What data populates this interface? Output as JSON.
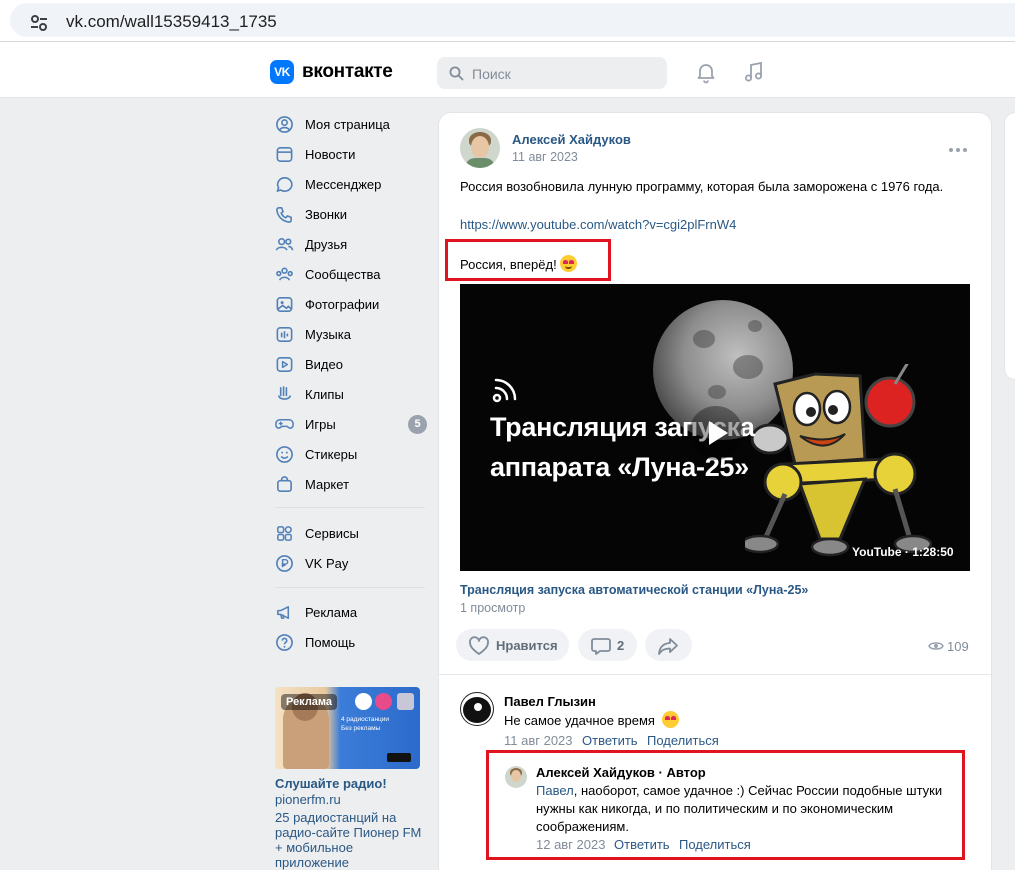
{
  "browser": {
    "url": "vk.com/wall15359413_1735"
  },
  "header": {
    "logo_text": "вконтакте",
    "logo_mark": "VK",
    "search_placeholder": "Поиск"
  },
  "sidebar": {
    "items": [
      {
        "label": "Моя страница",
        "icon": "user-circle-icon"
      },
      {
        "label": "Новости",
        "icon": "news-icon"
      },
      {
        "label": "Мессенджер",
        "icon": "message-icon"
      },
      {
        "label": "Звонки",
        "icon": "phone-icon"
      },
      {
        "label": "Друзья",
        "icon": "friends-icon"
      },
      {
        "label": "Сообщества",
        "icon": "communities-icon"
      },
      {
        "label": "Фотографии",
        "icon": "photo-icon"
      },
      {
        "label": "Музыка",
        "icon": "music-icon"
      },
      {
        "label": "Видео",
        "icon": "video-icon"
      },
      {
        "label": "Клипы",
        "icon": "clips-icon"
      },
      {
        "label": "Игры",
        "icon": "gamepad-icon",
        "badge": "5"
      },
      {
        "label": "Стикеры",
        "icon": "sticker-icon"
      },
      {
        "label": "Маркет",
        "icon": "market-icon"
      },
      {
        "label": "Сервисы",
        "icon": "services-icon"
      },
      {
        "label": "VK Pay",
        "icon": "vkpay-icon"
      },
      {
        "label": "Реклама",
        "icon": "megaphone-icon"
      },
      {
        "label": "Помощь",
        "icon": "help-icon"
      }
    ]
  },
  "ad": {
    "tag": "Реклама",
    "image_line1": "4 радиостанции",
    "image_line2": "Без рекламы",
    "title": "Слушайте радио!",
    "domain": "pionerfm.ru",
    "description": "25 радиостанций на радио-сайте Пионер FM + мобильное приложение"
  },
  "post": {
    "author": "Алексей Хайдуков",
    "date": "11 авг 2023",
    "text": "Россия возобновила лунную программу, которая была заморожена с 1976 года.",
    "link": "https://www.youtube.com/watch?v=cgi2plFrnW4",
    "text2": "Россия, вперёд!",
    "video": {
      "title_line1": "Трансляция запуска",
      "title_line2": "аппарата «Луна-25»",
      "duration": "YouTube · 1:28:50",
      "caption": "Трансляция запуска автоматической станции «Луна-25»",
      "views": "1 просмотр"
    },
    "actions": {
      "like": "Нравится",
      "comments": "2",
      "views": "109"
    }
  },
  "comments": [
    {
      "author": "Павел Глызин",
      "text": "Не самое удачное время",
      "date": "11 авг 2023",
      "reply": "Ответить",
      "share": "Поделиться"
    },
    {
      "author": "Алексей Хайдуков · Автор",
      "mention": "Павел",
      "text_line1": ", наоборот, самое удачное :) Сейчас России подобные штуки",
      "text_line2": "нужны как никогда, и по политическим и по экономическим",
      "text_line3": "соображениям.",
      "date": "12 авг 2023",
      "reply": "Ответить",
      "share": "Поделиться"
    }
  ],
  "colors": {
    "vk_blue": "#0077ff",
    "link": "#2a5885",
    "highlight": "#e0141e",
    "bg": "#edeef0"
  }
}
